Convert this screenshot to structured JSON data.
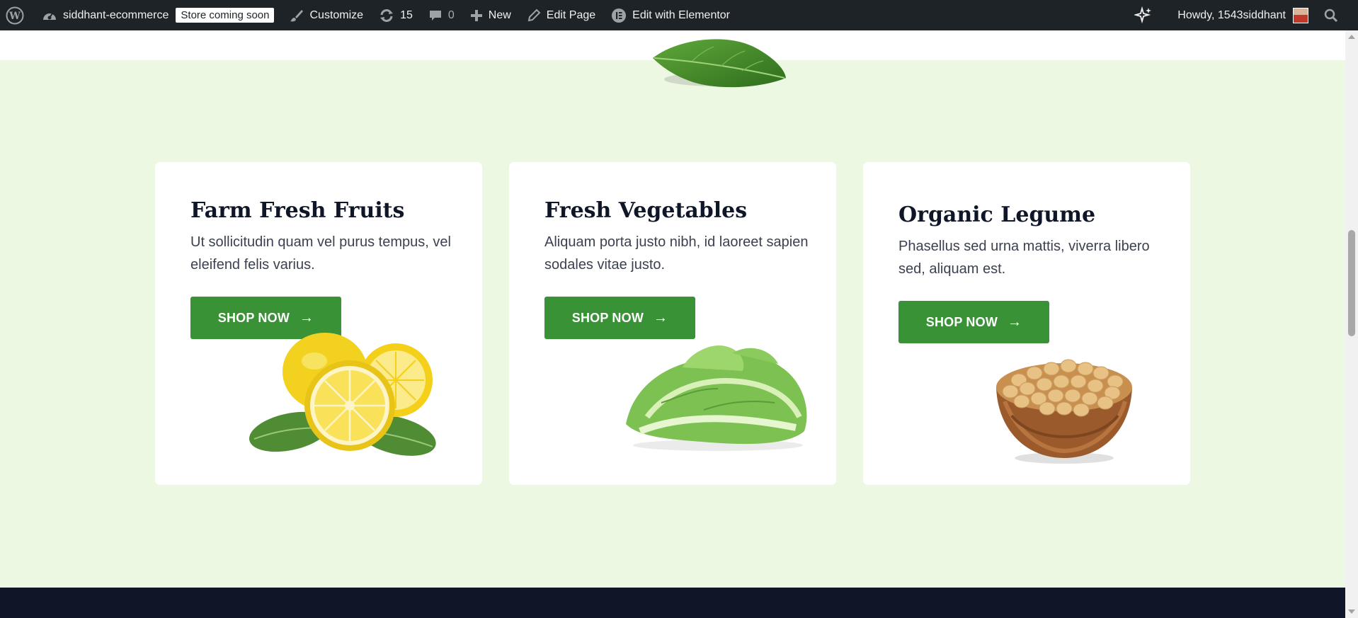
{
  "adminbar": {
    "site_name": "siddhant-ecommerce",
    "badge": "Store coming soon",
    "customize": "Customize",
    "updates_count": "15",
    "comments_count": "0",
    "new": "New",
    "edit_page": "Edit Page",
    "edit_elementor": "Edit with Elementor",
    "howdy": "Howdy, 1543siddhant"
  },
  "cards": [
    {
      "title": "Farm Fresh Fruits",
      "desc": "Ut sollicitudin quam vel purus tempus, vel eleifend felis varius.",
      "button": "SHOP NOW",
      "image_icon": "lemons-image"
    },
    {
      "title": "Fresh Vegetables",
      "desc": "Aliquam porta justo nibh, id laoreet sapien sodales vitae justo.",
      "button": "SHOP NOW",
      "image_icon": "lettuce-image"
    },
    {
      "title": "Organic Legume",
      "desc": "Phasellus sed urna mattis, viverra libero sed, aliquam est.",
      "button": "SHOP NOW",
      "image_icon": "soybeans-bowl-image"
    }
  ],
  "colors": {
    "adminbar_bg": "#1d2327",
    "section_bg": "#edf8e3",
    "button_green": "#3a9237",
    "footer_dark": "#0e1627",
    "title_color": "#0e1627"
  }
}
